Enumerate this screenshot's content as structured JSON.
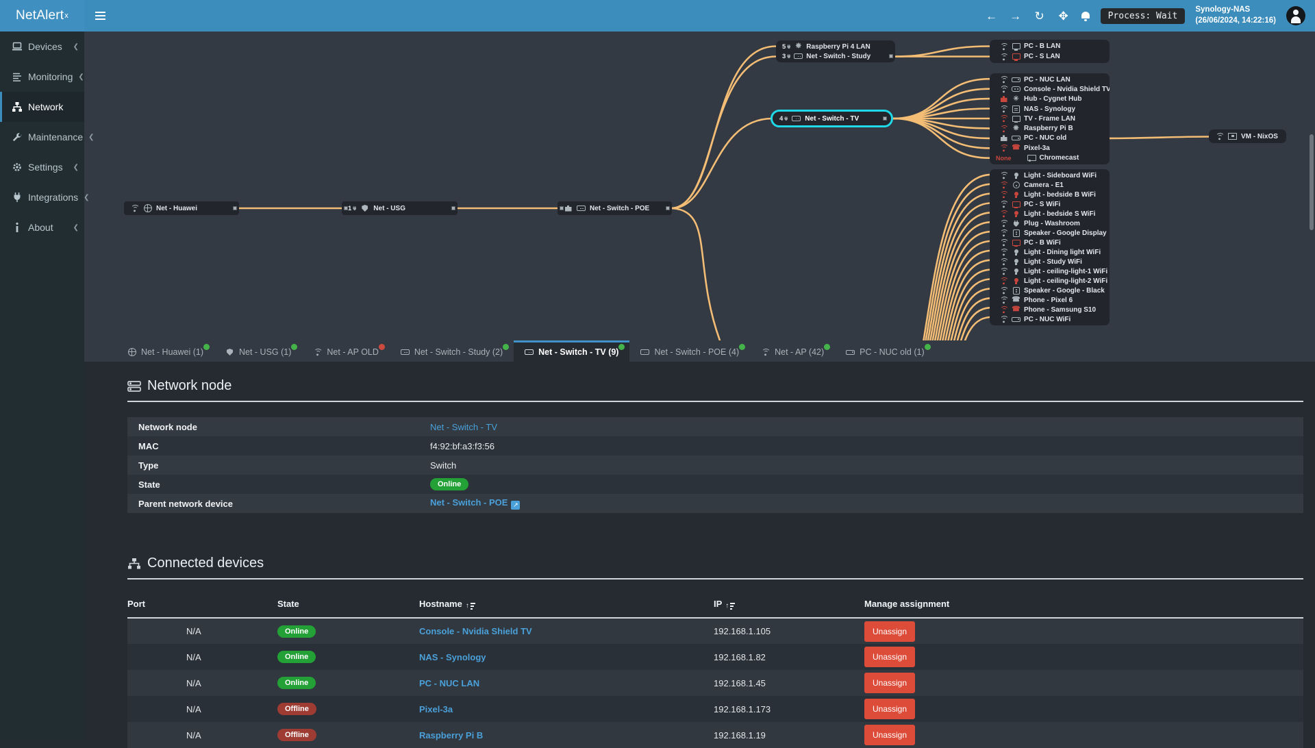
{
  "app": {
    "brand": "NetAlert",
    "brand_sup": "x"
  },
  "colors": {
    "navbar": "#3c8dbc",
    "sidebar": "#222d32",
    "diagram_bg": "#343a43",
    "content_bg": "#262b31",
    "edge": "#f4bd75",
    "selected_node_border": "#1fd8e8",
    "link": "#4aa0d9",
    "online": "#23a036",
    "offline": "#9e3c34",
    "danger": "#dd4b39",
    "tab_dot_green": "#43b34a",
    "tab_dot_red": "#cc4b3e"
  },
  "header": {
    "process_badge": "Process: Wait",
    "host": "Synology-NAS",
    "timestamp": "(26/06/2024, 14:22:16)"
  },
  "sidebar": {
    "items": [
      {
        "icon": "laptop",
        "label": "Devices",
        "chevron": "❮",
        "cls": ""
      },
      {
        "icon": "chart",
        "label": "Monitoring",
        "chevron": "❮",
        "cls": ""
      },
      {
        "icon": "sitemap",
        "label": "Network",
        "chevron": "",
        "cls": "active"
      },
      {
        "icon": "wrench",
        "label": "Maintenance",
        "chevron": "❮",
        "cls": ""
      },
      {
        "icon": "gear",
        "label": "Settings",
        "chevron": "❮",
        "cls": ""
      },
      {
        "icon": "plug",
        "label": "Integrations",
        "chevron": "❮",
        "cls": ""
      },
      {
        "icon": "info",
        "label": "About",
        "chevron": "❮",
        "cls": ""
      }
    ]
  },
  "diagram": {
    "huawei": {
      "label": "Net - Huawei"
    },
    "usg": {
      "count": "1",
      "label": "Net - USG"
    },
    "poe": {
      "label": "Net - Switch - POE"
    },
    "study_box": [
      {
        "count": "5",
        "icon": "raspberry",
        "icon_state": "ok",
        "label": "Raspberry Pi 4 LAN",
        "conn": "",
        "conn_state": "",
        "conn_label": ""
      },
      {
        "count": "3",
        "icon": "switch",
        "icon_state": "ok",
        "label": "Net - Switch - Study",
        "conn": "",
        "conn_state": "",
        "conn_label": "",
        "tail": "connector"
      }
    ],
    "tv": {
      "count": "4",
      "label": "Net - Switch - TV"
    },
    "vm": {
      "label": "VM - NixOS"
    },
    "study_children": [
      {
        "conn": "wifi",
        "conn_state": "ok",
        "conn_label": "",
        "icon": "display",
        "icon_state": "ok",
        "label": "PC - B LAN"
      },
      {
        "conn": "wifi",
        "conn_state": "ok",
        "conn_label": "",
        "icon": "display",
        "icon_state": "bad",
        "label": "PC - S LAN"
      }
    ],
    "tv_children": [
      {
        "conn": "wifi",
        "conn_state": "ok",
        "conn_label": "",
        "icon": "minipc",
        "icon_state": "ok",
        "label": "PC - NUC LAN"
      },
      {
        "conn": "wifi",
        "conn_state": "ok",
        "conn_label": "",
        "icon": "console",
        "icon_state": "ok",
        "label": "Console - Nvidia Shield TV"
      },
      {
        "conn": "eth",
        "conn_state": "bad",
        "conn_label": "",
        "icon": "hub",
        "icon_state": "ok",
        "label": "Hub - Cygnet Hub"
      },
      {
        "conn": "wifi",
        "conn_state": "ok",
        "conn_label": "",
        "icon": "nas",
        "icon_state": "ok",
        "label": "NAS - Synology"
      },
      {
        "conn": "wifi",
        "conn_state": "bad",
        "conn_label": "",
        "icon": "tv",
        "icon_state": "ok",
        "label": "TV - Frame LAN"
      },
      {
        "conn": "wifi",
        "conn_state": "bad",
        "conn_label": "",
        "icon": "raspberry",
        "icon_state": "ok",
        "label": "Raspberry Pi B"
      },
      {
        "conn": "eth",
        "conn_state": "ok",
        "conn_label": "",
        "icon": "minipc",
        "icon_state": "ok",
        "label": "PC - NUC old",
        "tail": "connector"
      },
      {
        "conn": "wifi",
        "conn_state": "bad",
        "conn_label": "",
        "icon": "phone",
        "icon_state": "bad",
        "label": "Pixel-3a"
      },
      {
        "conn": "none",
        "conn_state": "bad",
        "conn_label": "None",
        "icon": "cast",
        "icon_state": "ok",
        "label": "Chromecast"
      }
    ],
    "ap_children": [
      {
        "conn": "wifi",
        "conn_state": "ok",
        "conn_label": "",
        "icon": "bulb",
        "icon_state": "ok",
        "label": "Light - Sideboard WiFi"
      },
      {
        "conn": "wifi",
        "conn_state": "bad",
        "conn_label": "",
        "icon": "camera",
        "icon_state": "ok",
        "label": "Camera - E1"
      },
      {
        "conn": "wifi",
        "conn_state": "bad",
        "conn_label": "",
        "icon": "bulb",
        "icon_state": "bad",
        "label": "Light - bedside B WiFi"
      },
      {
        "conn": "wifi",
        "conn_state": "ok",
        "conn_label": "",
        "icon": "display",
        "icon_state": "bad",
        "label": "PC - S WiFi"
      },
      {
        "conn": "wifi",
        "conn_state": "bad",
        "conn_label": "",
        "icon": "bulb",
        "icon_state": "bad",
        "label": "Light - bedside S WiFi"
      },
      {
        "conn": "wifi",
        "conn_state": "ok",
        "conn_label": "",
        "icon": "plug",
        "icon_state": "ok",
        "label": "Plug - Washroom"
      },
      {
        "conn": "wifi",
        "conn_state": "ok",
        "conn_label": "",
        "icon": "speaker",
        "icon_state": "ok",
        "label": "Speaker - Google Display"
      },
      {
        "conn": "wifi",
        "conn_state": "ok",
        "conn_label": "",
        "icon": "display",
        "icon_state": "bad",
        "label": "PC - B WiFi"
      },
      {
        "conn": "wifi",
        "conn_state": "ok",
        "conn_label": "",
        "icon": "bulb",
        "icon_state": "ok",
        "label": "Light - Dining light WiFi"
      },
      {
        "conn": "wifi",
        "conn_state": "ok",
        "conn_label": "",
        "icon": "bulb",
        "icon_state": "ok",
        "label": "Light - Study WiFi"
      },
      {
        "conn": "wifi",
        "conn_state": "ok",
        "conn_label": "",
        "icon": "bulb",
        "icon_state": "ok",
        "label": "Light - ceiling-light-1 WiFi"
      },
      {
        "conn": "wifi",
        "conn_state": "bad",
        "conn_label": "",
        "icon": "bulb",
        "icon_state": "bad",
        "label": "Light - ceiling-light-2 WiFi"
      },
      {
        "conn": "wifi",
        "conn_state": "ok",
        "conn_label": "",
        "icon": "speaker",
        "icon_state": "ok",
        "label": "Speaker - Google - Black"
      },
      {
        "conn": "wifi",
        "conn_state": "ok",
        "conn_label": "",
        "icon": "phone",
        "icon_state": "ok",
        "label": "Phone - Pixel 6"
      },
      {
        "conn": "wifi",
        "conn_state": "bad",
        "conn_label": "",
        "icon": "phone",
        "icon_state": "bad",
        "label": "Phone - Samsung S10"
      },
      {
        "conn": "wifi",
        "conn_state": "ok",
        "conn_label": "",
        "icon": "minipc",
        "icon_state": "ok",
        "label": "PC - NUC WiFi"
      }
    ]
  },
  "tabs": [
    {
      "icon": "globe",
      "label": "Net - Huawei (1)",
      "dot": "g",
      "cls": ""
    },
    {
      "icon": "shield",
      "label": "Net - USG (1)",
      "dot": "g",
      "cls": ""
    },
    {
      "icon": "wifi",
      "label": "Net - AP OLD",
      "dot": "r",
      "cls": ""
    },
    {
      "icon": "switch",
      "label": "Net - Switch - Study (2)",
      "dot": "g",
      "cls": ""
    },
    {
      "icon": "switch",
      "label": "Net - Switch - TV (9)",
      "dot": "g",
      "cls": "active"
    },
    {
      "icon": "switch",
      "label": "Net - Switch - POE (4)",
      "dot": "g",
      "cls": ""
    },
    {
      "icon": "wifi",
      "label": "Net - AP (42)",
      "dot": "g",
      "cls": ""
    },
    {
      "icon": "minipc",
      "label": "PC - NUC old (1)",
      "dot": "g",
      "cls": ""
    }
  ],
  "node_section": {
    "title": "Network node",
    "rows": {
      "node": {
        "label": "Network node",
        "value": "Net - Switch - TV"
      },
      "mac": {
        "label": "MAC",
        "value": "f4:92:bf:a3:f3:56"
      },
      "type": {
        "label": "Type",
        "value": "Switch"
      },
      "state": {
        "label": "State",
        "value": "Online"
      },
      "parent": {
        "label": "Parent network device",
        "value": "Net - Switch - POE"
      }
    }
  },
  "devices_section": {
    "title": "Connected devices",
    "columns": {
      "port": "Port",
      "state": "State",
      "hostname": "Hostname",
      "ip": "IP",
      "manage": "Manage assignment"
    },
    "rows": [
      {
        "port": "N/A",
        "state": "Online",
        "state_cls": "online",
        "hostname": "Console - Nvidia Shield TV",
        "ip": "192.168.1.105",
        "action": "Unassign"
      },
      {
        "port": "N/A",
        "state": "Online",
        "state_cls": "online",
        "hostname": "NAS - Synology",
        "ip": "192.168.1.82",
        "action": "Unassign"
      },
      {
        "port": "N/A",
        "state": "Online",
        "state_cls": "online",
        "hostname": "PC - NUC LAN",
        "ip": "192.168.1.45",
        "action": "Unassign"
      },
      {
        "port": "N/A",
        "state": "Offline",
        "state_cls": "offline",
        "hostname": "Pixel-3a",
        "ip": "192.168.1.173",
        "action": "Unassign"
      },
      {
        "port": "N/A",
        "state": "Offline",
        "state_cls": "offline",
        "hostname": "Raspberry Pi B",
        "ip": "192.168.1.19",
        "action": "Unassign"
      }
    ]
  }
}
